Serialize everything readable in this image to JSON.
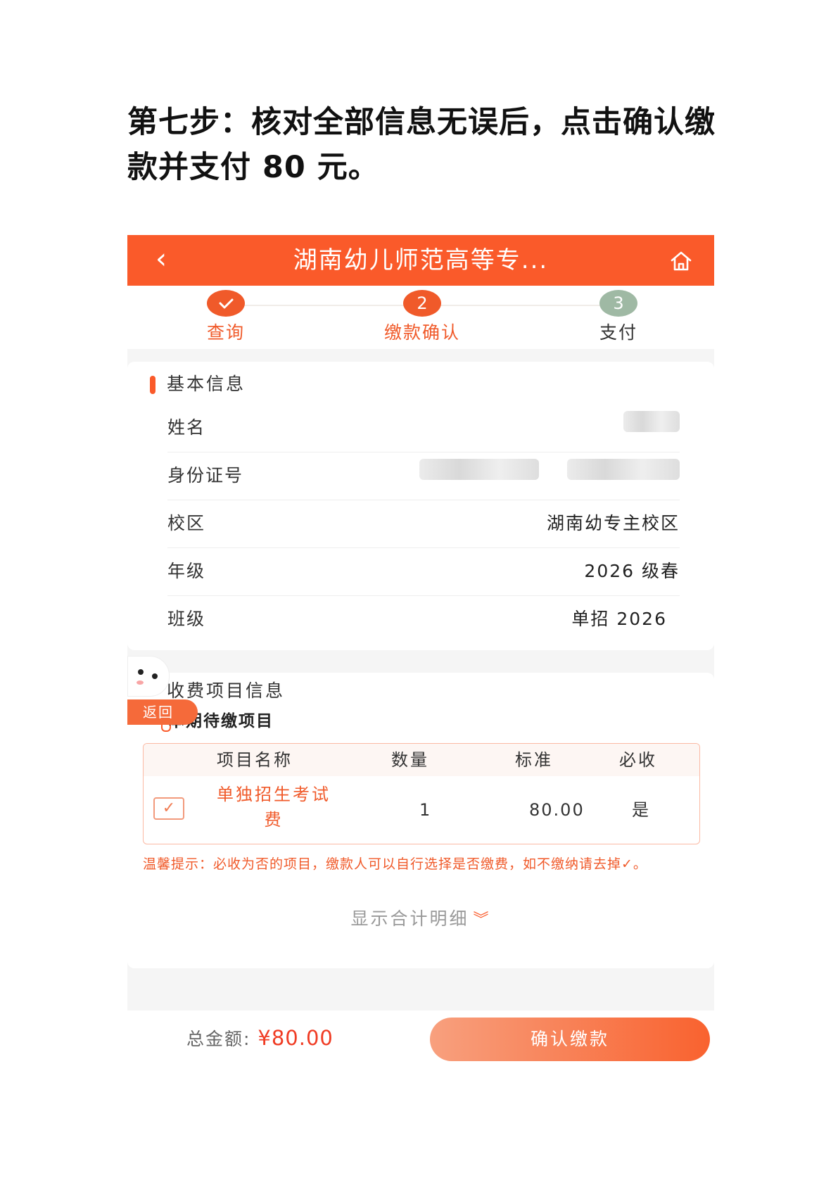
{
  "heading": {
    "line1": "第七步：核对全部信息无误后，点击确认缴",
    "line2": "款并支付 80 元。"
  },
  "topbar": {
    "back_icon": "chevron-left-icon",
    "title": "湖南幼儿师范高等专...",
    "home_icon": "home-icon"
  },
  "steps": [
    {
      "number": "✓",
      "label": "查询",
      "status": "done",
      "color": "#f05a2a"
    },
    {
      "number": "2",
      "label": "缴款确认",
      "status": "current",
      "color": "#f05a2a"
    },
    {
      "number": "3",
      "label": "支付",
      "status": "pending",
      "color": "#9fb9a4"
    }
  ],
  "basic_info": {
    "title": "基本信息",
    "rows": [
      {
        "label": "姓名",
        "value": ""
      },
      {
        "label": "身份证号",
        "value": ""
      },
      {
        "label": "校区",
        "value": "湖南幼专主校区"
      },
      {
        "label": "年级",
        "value": "2026 级春"
      },
      {
        "label": "班级",
        "value": "单招 2026"
      }
    ]
  },
  "fee_info": {
    "title": "收费项目信息",
    "subtitle": "本期待缴项目",
    "columns": [
      "项目名称",
      "数量",
      "标准",
      "必收"
    ],
    "items": [
      {
        "checked": true,
        "name_line1": "单独招生考试",
        "name_line2": "费",
        "qty": "1",
        "standard": "80.00",
        "required": "是"
      }
    ],
    "tip": "温馨提示：必收为否的项目，缴款人可以自行选择是否缴费，如不缴纳请去掉✓。",
    "show_detail": "显示合计明细",
    "show_detail_icon": "double-chevron-down-icon"
  },
  "float_back": {
    "mascot_icon": "mascot-icon",
    "label": "返回"
  },
  "bottom": {
    "total_label": "总金额:",
    "total_amount": "¥80.00",
    "confirm_label": "确认缴款"
  },
  "colors": {
    "brand": "#fa5a2a",
    "price": "#f03c24"
  }
}
